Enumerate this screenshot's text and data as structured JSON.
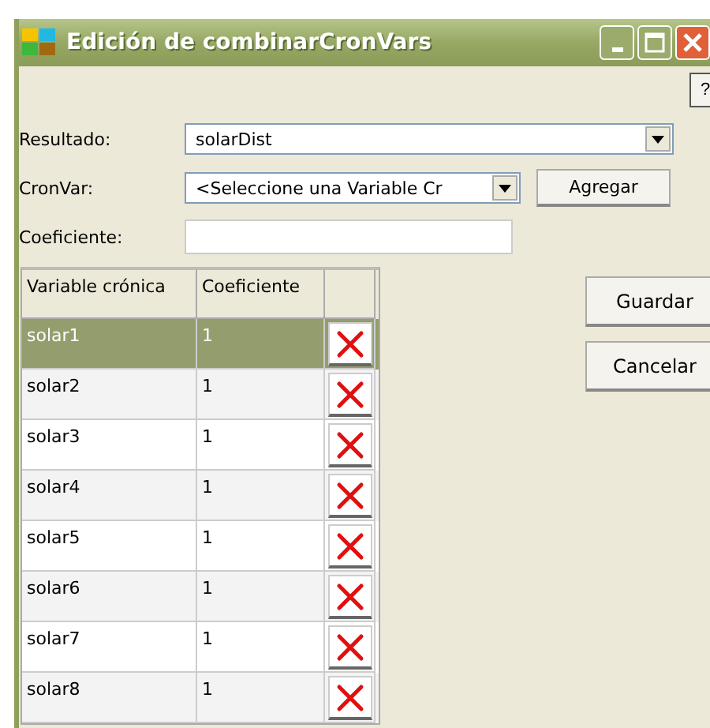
{
  "window": {
    "title": "Edición de combinarCronVars",
    "help": "?"
  },
  "form": {
    "resultado": {
      "label": "Resultado:",
      "value": "solarDist"
    },
    "cronvar": {
      "label": "CronVar:",
      "value": "<Seleccione una Variable Cr"
    },
    "add_button": "Agregar",
    "coeficiente": {
      "label": "Coeficiente:"
    }
  },
  "table": {
    "columns": [
      "Variable crónica",
      "Coeficiente"
    ],
    "rows": [
      {
        "variable": "solar1",
        "coeficiente": "1",
        "selected": true
      },
      {
        "variable": "solar2",
        "coeficiente": "1",
        "selected": false
      },
      {
        "variable": "solar3",
        "coeficiente": "1",
        "selected": false
      },
      {
        "variable": "solar4",
        "coeficiente": "1",
        "selected": false
      },
      {
        "variable": "solar5",
        "coeficiente": "1",
        "selected": false
      },
      {
        "variable": "solar6",
        "coeficiente": "1",
        "selected": false
      },
      {
        "variable": "solar7",
        "coeficiente": "1",
        "selected": false
      },
      {
        "variable": "solar8",
        "coeficiente": "1",
        "selected": false
      }
    ]
  },
  "buttons": [
    "Guardar",
    "Cancelar"
  ]
}
